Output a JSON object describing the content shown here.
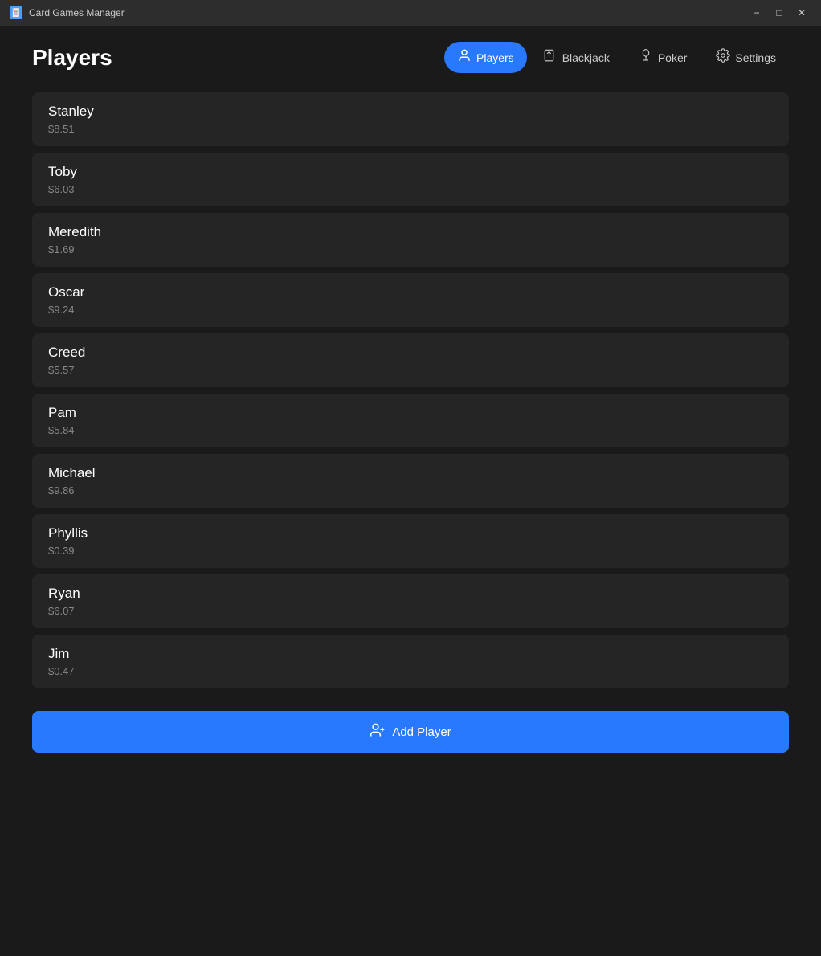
{
  "app": {
    "title": "Card Games Manager"
  },
  "titlebar": {
    "minimize_label": "−",
    "maximize_label": "□",
    "close_label": "✕"
  },
  "header": {
    "page_title": "Players"
  },
  "nav": {
    "items": [
      {
        "id": "players",
        "label": "Players",
        "active": true
      },
      {
        "id": "blackjack",
        "label": "Blackjack",
        "active": false
      },
      {
        "id": "poker",
        "label": "Poker",
        "active": false
      },
      {
        "id": "settings",
        "label": "Settings",
        "active": false
      }
    ]
  },
  "players": [
    {
      "name": "Stanley",
      "balance": "$8.51"
    },
    {
      "name": "Toby",
      "balance": "$6.03"
    },
    {
      "name": "Meredith",
      "balance": "$1.69"
    },
    {
      "name": "Oscar",
      "balance": "$9.24"
    },
    {
      "name": "Creed",
      "balance": "$5.57"
    },
    {
      "name": "Pam",
      "balance": "$5.84"
    },
    {
      "name": "Michael",
      "balance": "$9.86"
    },
    {
      "name": "Phyllis",
      "balance": "$0.39"
    },
    {
      "name": "Ryan",
      "balance": "$6.07"
    },
    {
      "name": "Jim",
      "balance": "$0.47"
    }
  ],
  "add_player_button": {
    "label": "Add Player"
  }
}
